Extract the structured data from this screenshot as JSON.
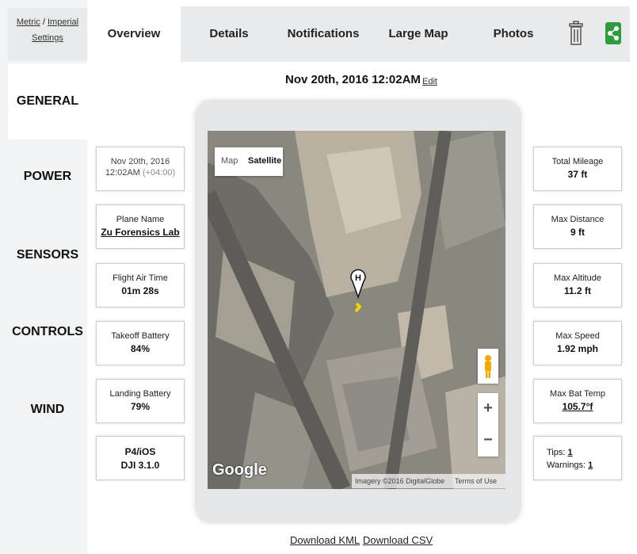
{
  "units": {
    "metric": "Metric",
    "separator": " / ",
    "imperial": "Imperial",
    "settings": "Settings"
  },
  "sidebar": {
    "items": [
      {
        "label": "GENERAL"
      },
      {
        "label": "POWER"
      },
      {
        "label": "SENSORS"
      },
      {
        "label": "CONTROLS"
      },
      {
        "label": "WIND"
      }
    ]
  },
  "tabs": [
    {
      "label": "Overview"
    },
    {
      "label": "Details"
    },
    {
      "label": "Notifications"
    },
    {
      "label": "Large Map"
    },
    {
      "label": "Photos"
    }
  ],
  "icons": {
    "trash": "trash-icon",
    "share": "share-icon",
    "share_color": "#2e9d3e"
  },
  "header": {
    "date": "Nov 20th, 2016 12:02AM",
    "edit": "Edit"
  },
  "left_cards": {
    "date": {
      "line1": "Nov 20th, 2016",
      "line2": "12:02AM",
      "tz": "(+04:00)"
    },
    "plane_name": {
      "label": "Plane Name",
      "value": "Zu Forensics Lab"
    },
    "air_time": {
      "label": "Flight Air Time",
      "value": "01m 28s"
    },
    "takeoff_battery": {
      "label": "Takeoff Battery",
      "value": "84%"
    },
    "landing_battery": {
      "label": "Landing Battery",
      "value": "79%"
    },
    "platform": {
      "line1": "P4/iOS",
      "line2": "DJI 3.1.0"
    }
  },
  "right_cards": {
    "mileage": {
      "label": "Total Mileage",
      "value": "37 ft"
    },
    "distance": {
      "label": "Max Distance",
      "value": "9 ft"
    },
    "altitude": {
      "label": "Max Altitude",
      "value": "11.2 ft"
    },
    "speed": {
      "label": "Max Speed",
      "value": "1.92 mph"
    },
    "bat_temp": {
      "label": "Max Bat Temp",
      "value": "105.7°f"
    },
    "tips": {
      "label": "Tips:",
      "value": "1"
    },
    "warnings": {
      "label": "Warnings:",
      "value": "1"
    }
  },
  "map": {
    "type_map": "Map",
    "type_satellite": "Satellite",
    "home_marker": "H",
    "zoom_in": "+",
    "zoom_out": "−",
    "logo": "Google",
    "imagery": "Imagery ©2016 DigitalGlobe",
    "terms": "Terms of Use"
  },
  "downloads": {
    "kml": "Download KML",
    "csv": "Download CSV"
  }
}
